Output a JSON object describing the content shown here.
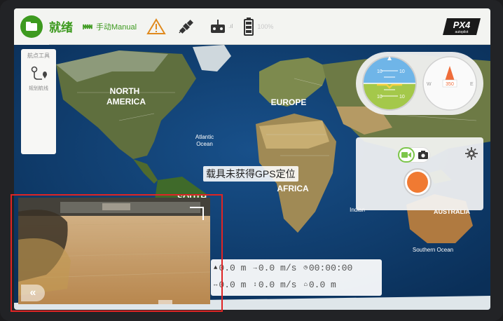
{
  "toolbar": {
    "status": "就绪",
    "flight_mode": "手动Manual",
    "battery_text": "100%",
    "logo_text": "PX4",
    "logo_sub": "autopilot"
  },
  "left_panel": {
    "title": "航点工具",
    "tool_label": "规划航线"
  },
  "map": {
    "labels": {
      "north_america_1": "NORTH",
      "north_america_2": "AMERICA",
      "europe": "EUROPE",
      "south_america": "SOUTH",
      "africa": "AFRICA",
      "atlantic_1": "Atlantic",
      "atlantic_2": "Ocean",
      "indian": "Indian",
      "southern_ocean": "Southern Ocean",
      "australia": "AUSTRALIA"
    }
  },
  "gps_message": "载具未获得GPS定位",
  "instruments": {
    "heading": "350",
    "pitch_top": "10",
    "pitch_mid": "10",
    "pitch_low": "10"
  },
  "camera": {
    "mode": "video"
  },
  "telemetry": {
    "altitude": "0.0 m",
    "ground_speed": "0.0 m/s",
    "flight_time": "00:00:00",
    "distance": "0.0 m",
    "climb_speed": "0.0 m/s",
    "home_distance": "0.0 m"
  },
  "colors": {
    "accent_green": "#3d9a1f",
    "record_orange": "#f07a32",
    "map_ocean": "#0c3a6b",
    "highlight_red": "#e02424"
  }
}
